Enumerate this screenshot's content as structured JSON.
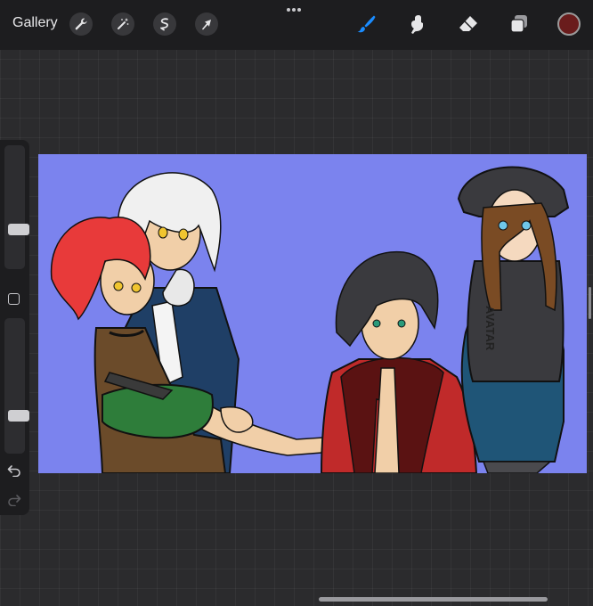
{
  "toolbar": {
    "gallery_label": "Gallery",
    "left_tools": [
      "wrench-icon",
      "magic-wand-icon",
      "selection-icon",
      "transform-arrow-icon"
    ],
    "right_tools": [
      "brush-icon",
      "smudge-icon",
      "eraser-icon",
      "layers-icon"
    ],
    "active_tool": "brush-icon",
    "accent_color": "#1a8cff",
    "current_color": "#6a1c1c"
  },
  "sidebar": {
    "brush_size_level": 0.3,
    "opacity_level": 0.26
  },
  "canvas": {
    "background_color": "#7b83ee",
    "artwork_text": "AVATAR"
  }
}
